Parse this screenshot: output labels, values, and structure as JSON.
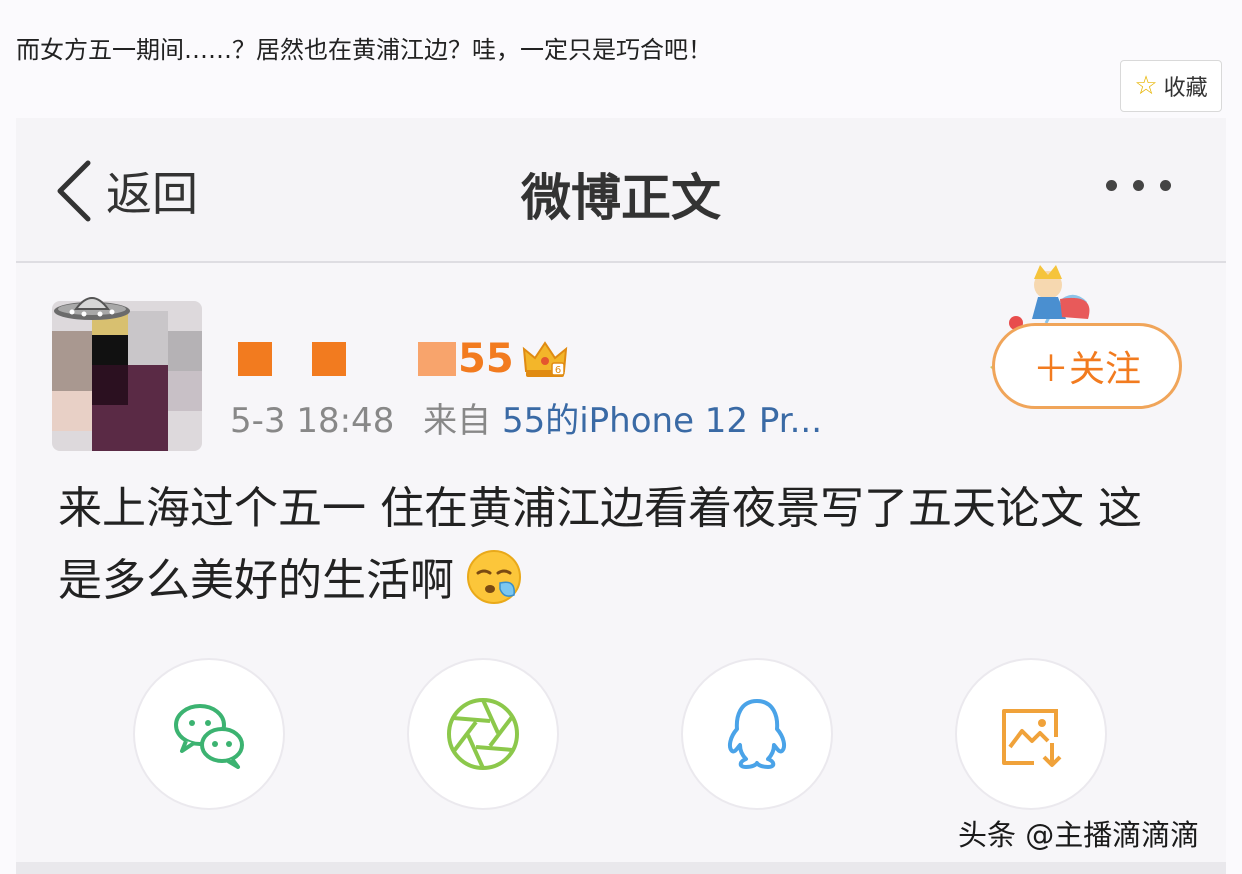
{
  "caption": "而女方五一期间……？居然也在黄浦江边？哇，一定只是巧合吧！",
  "favorite_button": {
    "icon": "star-icon",
    "label": "收藏"
  },
  "navbar": {
    "back_icon": "chevron-left-icon",
    "back_label": "返回",
    "title": "微博正文",
    "more_icon": "more-dots-icon"
  },
  "post": {
    "username_suffix": "55",
    "badge_icon": "crown-vip-icon",
    "time": "5-3 18:48",
    "from_label": "来自",
    "device": "55的iPhone 12 Pr...",
    "follow_label": "＋关注",
    "text": "来上海过个五一 住在黄浦江边看着夜景写了五天论文 这是多么美好的生活啊"
  },
  "share_buttons": [
    {
      "icon": "wechat-icon"
    },
    {
      "icon": "moments-icon"
    },
    {
      "icon": "qq-icon"
    },
    {
      "icon": "save-image-icon"
    }
  ],
  "watermark": "头条 @主播滴滴滴",
  "colors": {
    "accent_orange": "#f27b1f",
    "link_blue": "#3a6aa5",
    "wechat_green": "#3cb371"
  }
}
